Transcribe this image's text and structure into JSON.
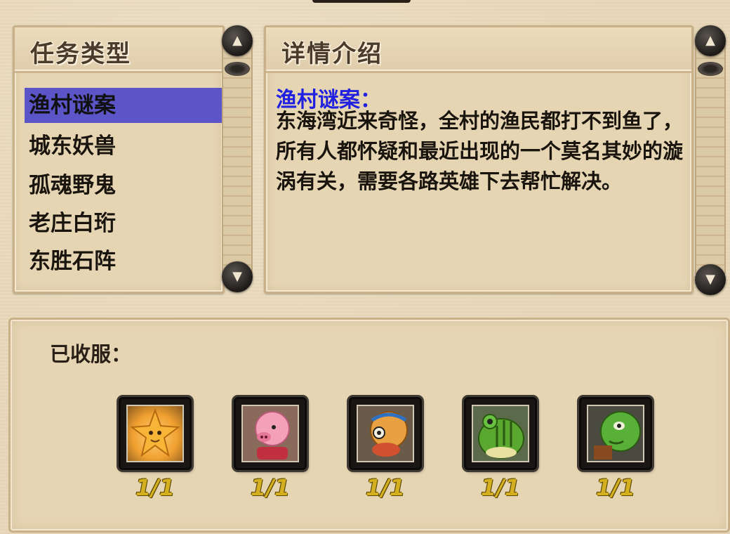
{
  "left_panel": {
    "title": "任务类型",
    "items": [
      {
        "label": "渔村谜案",
        "selected": true
      },
      {
        "label": "城东妖兽",
        "selected": false
      },
      {
        "label": "孤魂野鬼",
        "selected": false
      },
      {
        "label": "老庄白珩",
        "selected": false
      },
      {
        "label": "东胜石阵",
        "selected": false
      }
    ]
  },
  "right_panel": {
    "title": "详情介绍",
    "quest_name": "渔村谜案：",
    "description": "东海湾近来奇怪，全村的渔民都打不到鱼了，所有人都怀疑和最近出现的一个莫名其妙的漩涡有关，需要各路英雄下去帮忙解决。"
  },
  "captured": {
    "label": "已收服：",
    "pets": [
      {
        "icon": "star-creature-icon",
        "count": "1/1"
      },
      {
        "icon": "pink-pig-icon",
        "count": "1/1"
      },
      {
        "icon": "fish-monster-icon",
        "count": "1/1"
      },
      {
        "icon": "green-frog-icon",
        "count": "1/1"
      },
      {
        "icon": "green-turtle-icon",
        "count": "1/1"
      }
    ]
  },
  "colors": {
    "selected_bg": "#5b55c8",
    "quest_title": "#2020e0",
    "count_gold": "#d4b020"
  }
}
